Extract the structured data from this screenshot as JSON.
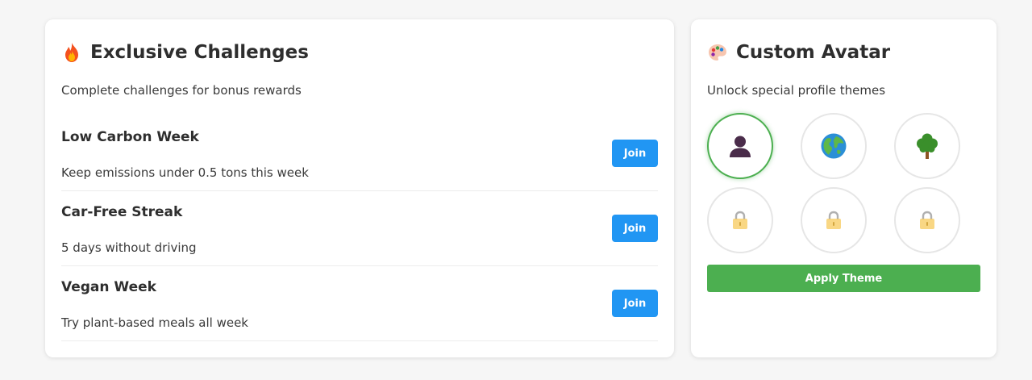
{
  "challenges": {
    "title": "Exclusive Challenges",
    "title_icon": "fire-icon",
    "subtitle": "Complete challenges for bonus rewards",
    "items": [
      {
        "name": "Low Carbon Week",
        "description": "Keep emissions under 0.5 tons this week",
        "button_label": "Join"
      },
      {
        "name": "Car-Free Streak",
        "description": "5 days without driving",
        "button_label": "Join"
      },
      {
        "name": "Vegan Week",
        "description": "Try plant-based meals all week",
        "button_label": "Join"
      }
    ],
    "button_color": "#2196f3"
  },
  "avatar": {
    "title": "Custom Avatar",
    "title_icon": "palette-icon",
    "subtitle": "Unlock special profile themes",
    "options": [
      {
        "icon": "person-silhouette-icon",
        "state": "selected"
      },
      {
        "icon": "globe-icon",
        "state": "unlocked"
      },
      {
        "icon": "tree-icon",
        "state": "unlocked"
      },
      {
        "icon": "lock-icon",
        "state": "locked"
      },
      {
        "icon": "lock-icon",
        "state": "locked"
      },
      {
        "icon": "lock-icon",
        "state": "locked"
      }
    ],
    "apply_label": "Apply Theme",
    "accent_color": "#4caf50"
  }
}
